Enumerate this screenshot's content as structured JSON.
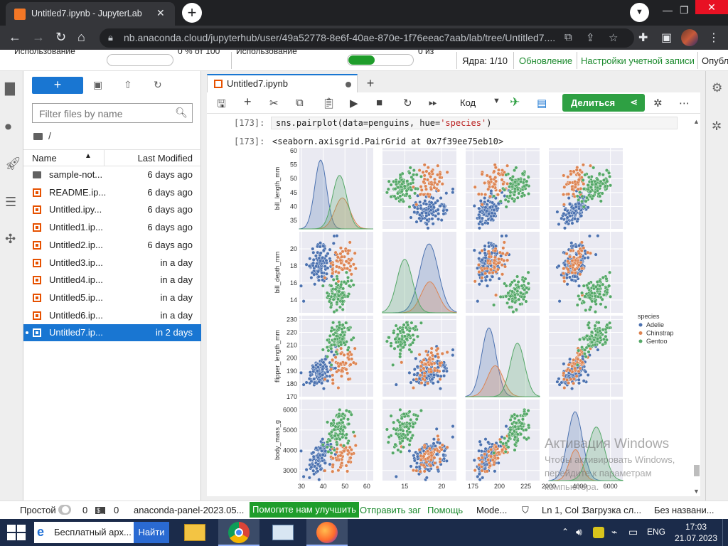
{
  "browser": {
    "tab_title": "Untitled7.ipynb - JupyterLab",
    "url": "nb.anaconda.cloud/jupyterhub/user/49a52778-8e6f-40ae-870e-1f76eeac7aab/lab/tree/Untitled7...."
  },
  "top_panel": {
    "usage_label_1": "Использование",
    "usage_value_1": "0 % от 100",
    "usage_label_2": "Использование",
    "usage_value_2": "0 из",
    "usage_progress_2": 0.4,
    "kernels": "Ядра: 1/10",
    "update_link": "Обновление",
    "account_link": "Настройки учетной записи",
    "publish_link": "Опубл"
  },
  "file_browser": {
    "new_button": "+",
    "filter_placeholder": "Filter files by name",
    "path": "/",
    "col_name": "Name",
    "col_modified": "Last Modified",
    "files": [
      {
        "name": "sample-not...",
        "modified": "6 days ago",
        "type": "folder"
      },
      {
        "name": "README.ip...",
        "modified": "6 days ago",
        "type": "notebook"
      },
      {
        "name": "Untitled.ipy...",
        "modified": "6 days ago",
        "type": "notebook"
      },
      {
        "name": "Untitled1.ip...",
        "modified": "6 days ago",
        "type": "notebook"
      },
      {
        "name": "Untitled2.ip...",
        "modified": "6 days ago",
        "type": "notebook"
      },
      {
        "name": "Untitled3.ip...",
        "modified": "in a day",
        "type": "notebook"
      },
      {
        "name": "Untitled4.ip...",
        "modified": "in a day",
        "type": "notebook"
      },
      {
        "name": "Untitled5.ip...",
        "modified": "in a day",
        "type": "notebook"
      },
      {
        "name": "Untitled6.ip...",
        "modified": "in a day",
        "type": "notebook"
      },
      {
        "name": "Untitled7.ip...",
        "modified": "in 2 days",
        "type": "notebook",
        "selected": true
      }
    ]
  },
  "notebook": {
    "tab_title": "Untitled7.ipynb",
    "kernel_type": "Код",
    "share_label": "Делиться",
    "cell_prompt_in": "[173]:",
    "cell_code_pre": "sns.pairplot(data=penguins, hue=",
    "cell_code_str": "'species'",
    "cell_code_post": ")",
    "cell_prompt_out": "[173]:",
    "output_text": "<seaborn.axisgrid.PairGrid at 0x7f39ee75eb10>"
  },
  "chart_data": {
    "type": "scatter",
    "subtype": "pairplot",
    "variables": [
      "bill_length_mm",
      "bill_depth_mm",
      "flipper_length_mm",
      "body_mass_g"
    ],
    "ylim": {
      "bill_length_mm": [
        32,
        61
      ],
      "bill_depth_mm": [
        12.5,
        22
      ],
      "flipper_length_mm": [
        170,
        233
      ],
      "body_mass_g": [
        2500,
        6500
      ]
    },
    "xlim": {
      "bill_length_mm": [
        29,
        63
      ],
      "bill_depth_mm": [
        12,
        22
      ],
      "flipper_length_mm": [
        168,
        238
      ],
      "body_mass_g": [
        2000,
        6800
      ]
    },
    "yticks": {
      "bill_length_mm": [
        35,
        40,
        45,
        50,
        55,
        60
      ],
      "bill_depth_mm": [
        14,
        16,
        18,
        20
      ],
      "flipper_length_mm": [
        170,
        180,
        190,
        200,
        210,
        220,
        230
      ],
      "body_mass_g": [
        3000,
        4000,
        5000,
        6000
      ]
    },
    "xticks": {
      "bill_length_mm": [
        30,
        40,
        50,
        60
      ],
      "bill_depth_mm": [
        15,
        20
      ],
      "flipper_length_mm": [
        175,
        200,
        225
      ],
      "body_mass_g": [
        2000,
        4000,
        6000
      ]
    },
    "legend_title": "species",
    "legend_position": "right",
    "series": [
      {
        "name": "Adelie",
        "color": "#4c72b0",
        "mean": [
          38.8,
          18.3,
          190,
          3700
        ],
        "sd": [
          2.6,
          1.2,
          6.5,
          460
        ]
      },
      {
        "name": "Chinstrap",
        "color": "#dd8452",
        "mean": [
          48.8,
          18.4,
          196,
          3730
        ],
        "sd": [
          3.3,
          1.1,
          7.1,
          380
        ]
      },
      {
        "name": "Gentoo",
        "color": "#55a868",
        "mean": [
          47.5,
          15.0,
          217,
          5080
        ],
        "sd": [
          3.1,
          1.0,
          6.5,
          500
        ]
      }
    ]
  },
  "watermark": {
    "line1": "Активация Windows",
    "line2": "Чтобы активировать Windows,",
    "line3": "перейдите к параметрам",
    "line4": "компьютера."
  },
  "status_bar": {
    "mode": "Простой",
    "zero1": "0",
    "zero2": "0",
    "panel": "anaconda-panel-2023.05...",
    "help": "Помогите нам улучшить",
    "report": "Отправить заг",
    "help2": "Помощь",
    "mode2": "Mode...",
    "position": "Ln 1, Col 1",
    "loading": "Загрузка сл...",
    "name": "Без названи..."
  },
  "taskbar": {
    "search_text": "Бесплатный арх...",
    "find_btn": "Найти",
    "lang": "ENG",
    "time": "17:03",
    "date": "21.07.2023"
  },
  "colors": {
    "accent": "#1976d2",
    "share": "#2ea043"
  }
}
